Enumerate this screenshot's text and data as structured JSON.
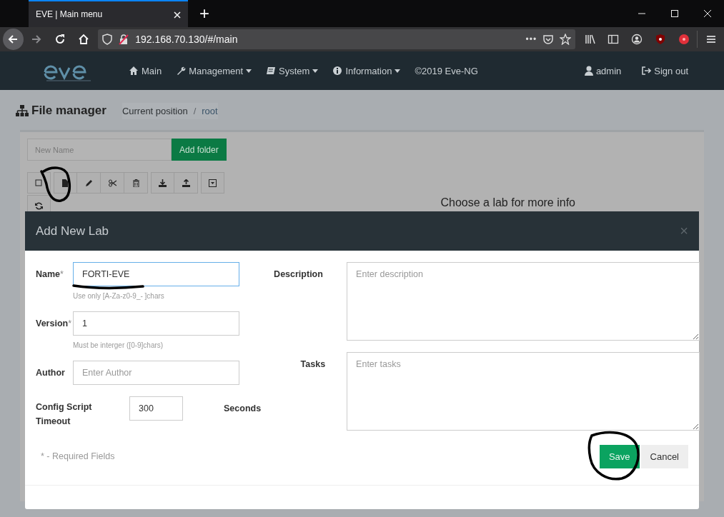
{
  "browser": {
    "tab_title": "EVE | Main menu",
    "new_tab": "+",
    "url": "192.168.70.130/#/main",
    "more": "•••"
  },
  "navbar": {
    "items": [
      {
        "label": "Main",
        "caret": false
      },
      {
        "label": "Management",
        "caret": true
      },
      {
        "label": "System",
        "caret": true
      },
      {
        "label": "Information",
        "caret": true
      },
      {
        "label": "©2019 Eve-NG",
        "caret": false
      }
    ],
    "user": "admin",
    "sign_out": "Sign out"
  },
  "page": {
    "title": "File manager",
    "separator": "/",
    "breadcrumb": [
      {
        "label": "Current position",
        "link": false
      },
      {
        "label": "root",
        "link": true
      }
    ],
    "new_folder": {
      "placeholder": "New Name",
      "button": "Add folder"
    },
    "info": "Choose a lab for more info"
  },
  "modal": {
    "title": "Add New Lab",
    "close": "×",
    "fields": [
      {
        "kind": "text",
        "label": "Name",
        "required_mark": "*",
        "value": "FORTI-EVE",
        "focused": true,
        "hint": "Use only [A-Za-z0-9_- ]chars"
      },
      {
        "kind": "text",
        "label": "Version",
        "required_mark": "*",
        "value": "1",
        "focused": false,
        "hint": "Must be interger ([0-9]chars)"
      },
      {
        "kind": "text",
        "label": "Author",
        "placeholder": "Enter Author",
        "focused": false
      },
      {
        "kind": "number",
        "label": "Config Script Timeout",
        "value": "300",
        "suffix": "Seconds"
      }
    ],
    "areas": [
      {
        "label": "Description",
        "placeholder": "Enter description"
      },
      {
        "label": "Tasks",
        "placeholder": "Enter tasks"
      }
    ],
    "required_note": "* - Required Fields",
    "buttons": [
      {
        "label": "Save",
        "kind": "primary"
      },
      {
        "label": "Cancel",
        "kind": "default"
      }
    ]
  }
}
